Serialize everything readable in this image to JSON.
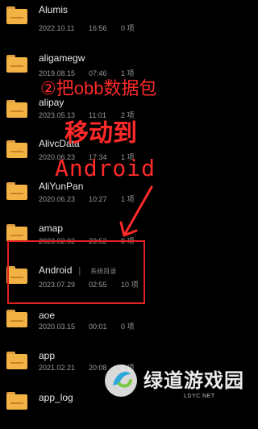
{
  "folders": [
    {
      "name": "Alumis",
      "date": "2022.10.11",
      "time": "16:56",
      "count": "0 项"
    },
    {
      "name": "aligamegw",
      "date": "2019.08.15",
      "time": "07:46",
      "count": "1 项"
    },
    {
      "name": "alipay",
      "date": "2023.05.13",
      "time": "11:01",
      "count": "2 项"
    },
    {
      "name": "AlivcData",
      "date": "2020.06.23",
      "time": "17:34",
      "count": "1 项"
    },
    {
      "name": "AliYunPan",
      "date": "2020.06.23",
      "time": "10:27",
      "count": "1 项"
    },
    {
      "name": "amap",
      "date": "2023.02.02",
      "time": "23:52",
      "count": "8 项"
    },
    {
      "name": "Android",
      "date": "2023.07.29",
      "time": "02:55",
      "count": "10 项",
      "tag": "系统目录"
    },
    {
      "name": "aoe",
      "date": "2020.03.15",
      "time": "00:01",
      "count": "0 项"
    },
    {
      "name": "app",
      "date": "2021.02.21",
      "time": "20:08",
      "count": "1 项"
    },
    {
      "name": "app_log",
      "date": "",
      "time": "",
      "count": ""
    }
  ],
  "annotations": {
    "step": "②把obb数据包",
    "move_to": "移动到",
    "target": "Android"
  },
  "watermark": {
    "text": "绿道游戏园",
    "sub": "LDYC.NET"
  },
  "colors": {
    "background": "#000000",
    "folder": "#f2b244",
    "annotation_red": "#e32121"
  },
  "icons": [
    "folder-icon",
    "arrow-annotation",
    "watermark-logo"
  ]
}
